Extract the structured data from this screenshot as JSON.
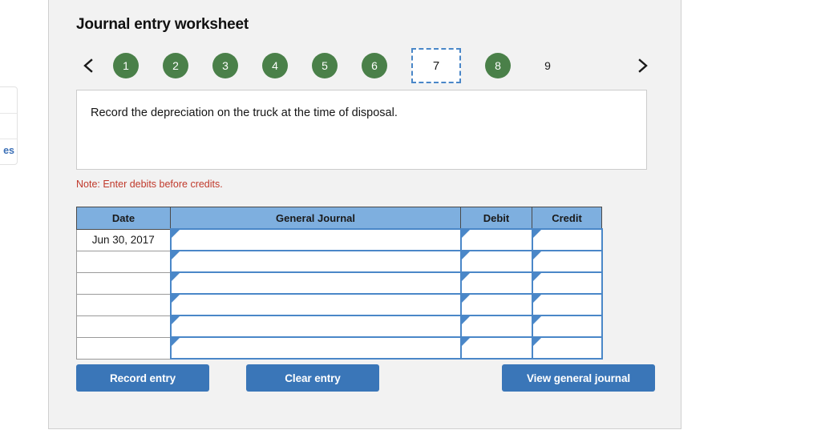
{
  "left_stub": {
    "link_fragment": "es"
  },
  "worksheet": {
    "title": "Journal entry worksheet",
    "pager": {
      "prev_icon": "chevron-left-icon",
      "next_icon": "chevron-right-icon",
      "steps": [
        {
          "label": "1",
          "state": "complete"
        },
        {
          "label": "2",
          "state": "complete"
        },
        {
          "label": "3",
          "state": "complete"
        },
        {
          "label": "4",
          "state": "complete"
        },
        {
          "label": "5",
          "state": "complete"
        },
        {
          "label": "6",
          "state": "complete"
        },
        {
          "label": "7",
          "state": "current"
        },
        {
          "label": "8",
          "state": "complete"
        },
        {
          "label": "9",
          "state": "pending"
        }
      ]
    },
    "instruction": "Record the depreciation on the truck at the time of disposal.",
    "note": "Note: Enter debits before credits.",
    "table": {
      "headers": [
        "Date",
        "General Journal",
        "Debit",
        "Credit"
      ],
      "rows": [
        {
          "date": "Jun 30, 2017",
          "general_journal": "",
          "debit": "",
          "credit": ""
        },
        {
          "date": "",
          "general_journal": "",
          "debit": "",
          "credit": ""
        },
        {
          "date": "",
          "general_journal": "",
          "debit": "",
          "credit": ""
        },
        {
          "date": "",
          "general_journal": "",
          "debit": "",
          "credit": ""
        },
        {
          "date": "",
          "general_journal": "",
          "debit": "",
          "credit": ""
        },
        {
          "date": "",
          "general_journal": "",
          "debit": "",
          "credit": ""
        }
      ]
    },
    "buttons": {
      "record": "Record entry",
      "clear": "Clear entry",
      "view": "View general journal"
    }
  },
  "colors": {
    "step_complete": "#4a8049",
    "step_current_border": "#4a87c8",
    "table_header": "#7eafdf",
    "cell_border": "#4a87c8",
    "button": "#3a76b8",
    "note": "#c0392b",
    "card_bg": "#f2f2f2"
  }
}
